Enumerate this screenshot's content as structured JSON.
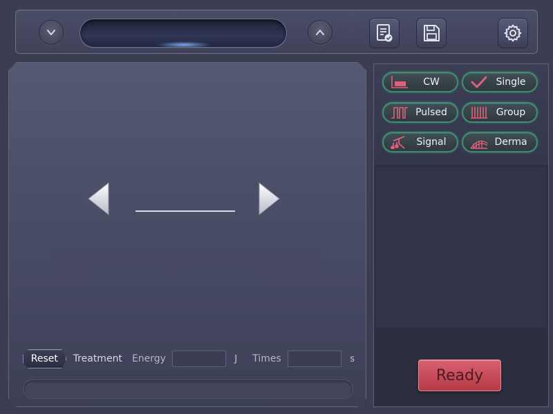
{
  "topbar": {
    "prev_icon": "chevron-down-icon",
    "next_icon": "chevron-up-icon",
    "display_text": "",
    "report_icon": "report-check-icon",
    "save_icon": "save-disk-icon",
    "settings_icon": "gear-icon"
  },
  "main": {
    "value": "",
    "info": "",
    "reset_label": "Reset",
    "mode_label": "Treatment",
    "energy_label": "Energy",
    "energy_value": "",
    "energy_unit": "J",
    "times_label": "Times",
    "times_value": "",
    "times_unit": "s",
    "status": ""
  },
  "modes": [
    {
      "label": "CW",
      "icon": "cw-wave-icon"
    },
    {
      "label": "Single",
      "icon": "checkmark-icon"
    },
    {
      "label": "Pulsed",
      "icon": "pulse-wave-icon"
    },
    {
      "label": "Group",
      "icon": "group-pulse-icon"
    },
    {
      "label": "Signal",
      "icon": "signal-music-icon"
    },
    {
      "label": "Derma",
      "icon": "derma-skin-icon"
    }
  ],
  "ready_label": "Ready",
  "colors": {
    "accent_red": "#d05462",
    "mode_border_green": "#3e8f6f",
    "icon_pink": "#e0607a"
  }
}
